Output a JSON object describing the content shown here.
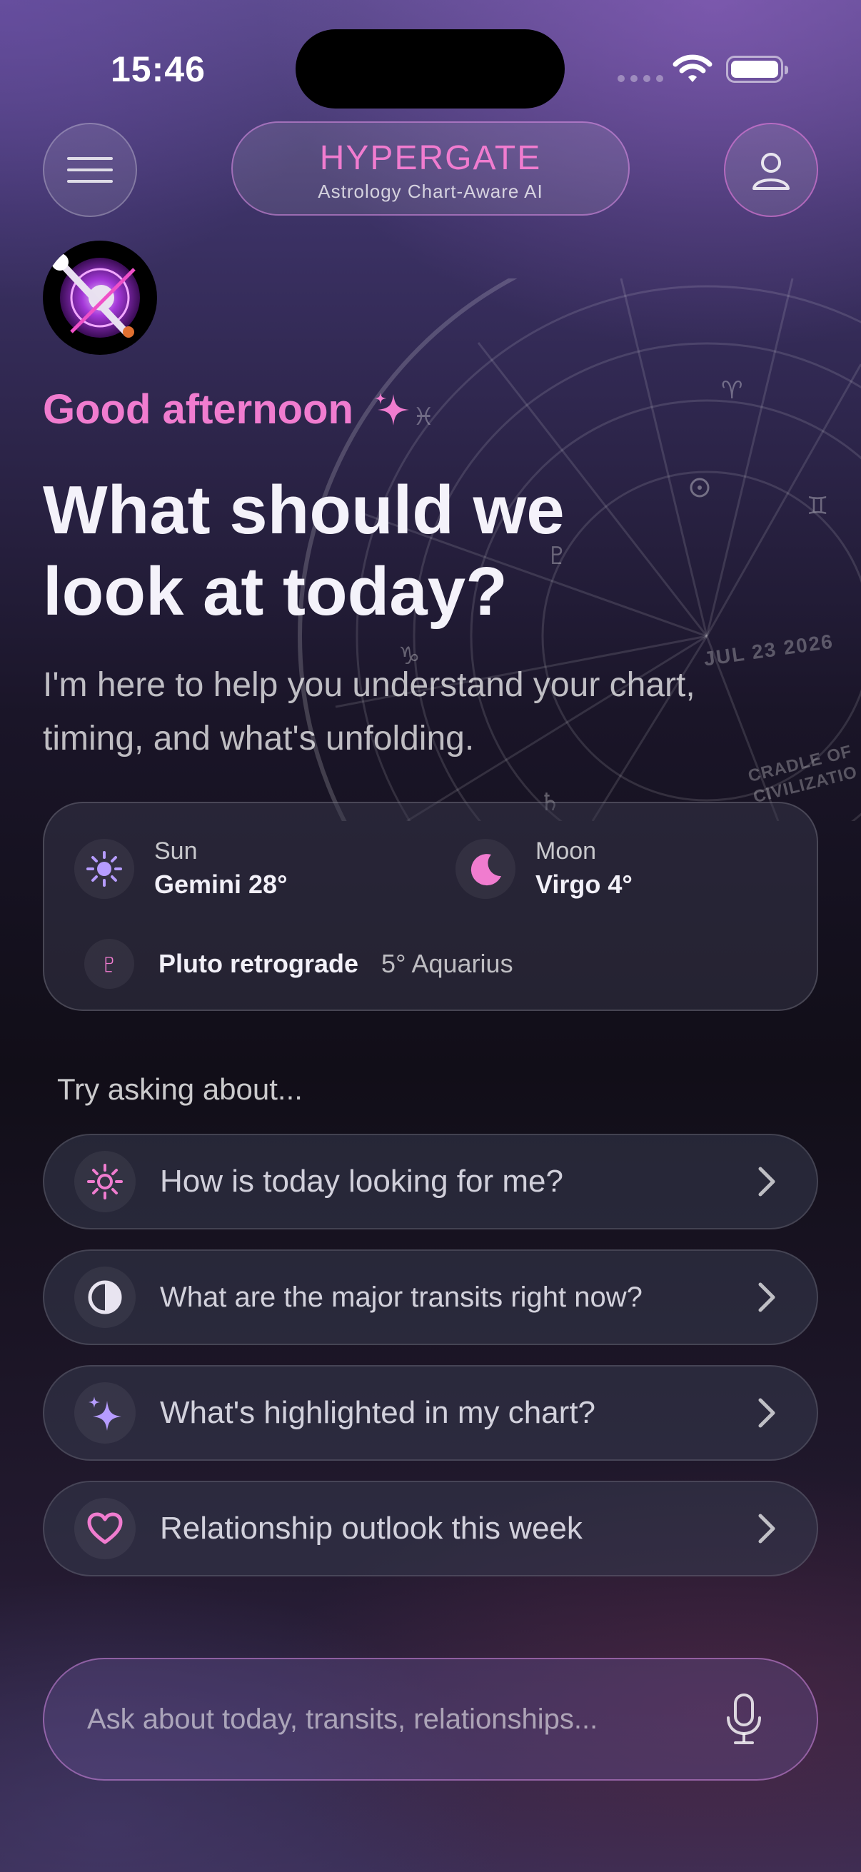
{
  "status_bar": {
    "time": "15:46"
  },
  "header": {
    "brand_title": "HYPERGATE",
    "brand_subtitle": "Astrology Chart-Aware AI"
  },
  "chart_wheel": {
    "date_label": "JUL 23 2026",
    "location_label_line1": "CRADLE OF",
    "location_label_line2": "CIVILIZATIO"
  },
  "greeting": "Good afternoon",
  "headline": "What should we look at today?",
  "subtext": "I'm here to help you understand your chart, timing, and what's unfolding.",
  "sky": {
    "sun": {
      "label": "Sun",
      "value": "Gemini 28°"
    },
    "moon": {
      "label": "Moon",
      "value": "Virgo 4°"
    },
    "retrograde": {
      "symbol": "♇",
      "title": "Pluto retrograde",
      "position": "5° Aquarius"
    }
  },
  "suggestions_label": "Try asking about...",
  "suggestions": [
    {
      "icon": "sun-icon",
      "text": "How is today looking for me?"
    },
    {
      "icon": "half-moon-icon",
      "text": "What are the major transits right now?"
    },
    {
      "icon": "sparkle-icon",
      "text": "What's highlighted in my chart?"
    },
    {
      "icon": "heart-icon",
      "text": "Relationship outlook this week"
    }
  ],
  "composer": {
    "placeholder": "Ask about today, transits, relationships..."
  },
  "colors": {
    "accent_pink": "#f07ccf",
    "accent_lavender": "#b69cff"
  }
}
